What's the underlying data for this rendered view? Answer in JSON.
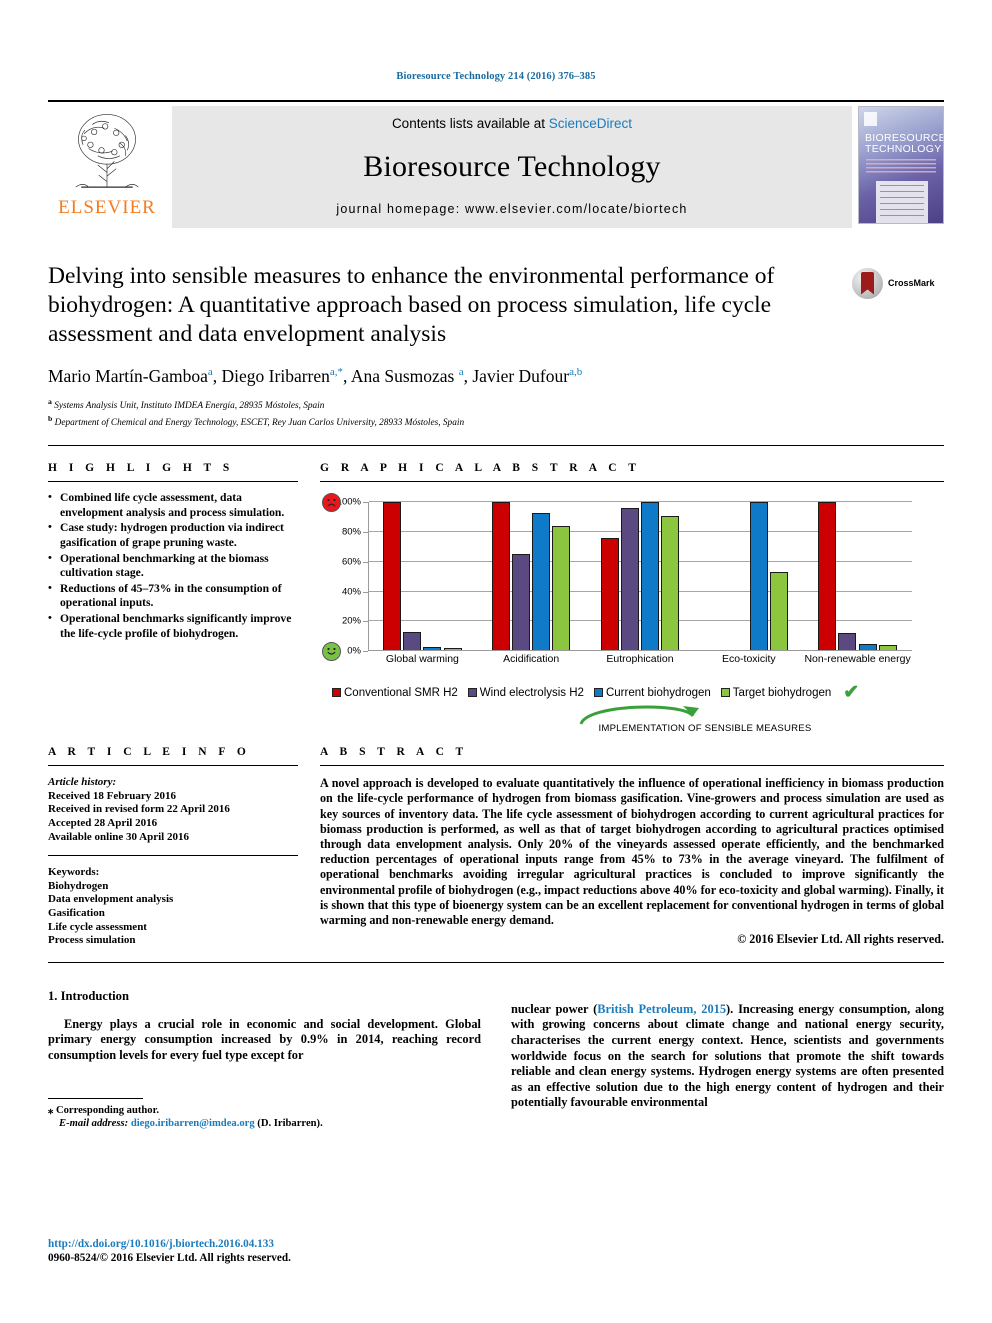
{
  "running_head": "Bioresource Technology 214 (2016) 376–385",
  "masthead": {
    "contents_prefix": "Contents lists available at ",
    "sciencedirect": "ScienceDirect",
    "journal_name": "Bioresource Technology",
    "homepage": "journal homepage: www.elsevier.com/locate/biortech",
    "publisher": "ELSEVIER",
    "cover_title_line1": "BIORESOURCE",
    "cover_title_line2": "TECHNOLOGY"
  },
  "article": {
    "title": "Delving into sensible measures to enhance the environmental performance of biohydrogen: A quantitative approach based on process simulation, life cycle assessment and data envelopment analysis",
    "crossmark_label": "CrossMark",
    "authors_html": "Mario Martín-Gamboa <sup>a</sup>, Diego Iribarren <sup>a,*</sup>, Ana Susmozas <sup>a</sup>, Javier Dufour<sup>a,b</sup>",
    "affiliation_a": "Systems Analysis Unit, Instituto IMDEA Energía, 28935 Móstoles, Spain",
    "affiliation_b": "Department of Chemical and Energy Technology, ESCET, Rey Juan Carlos University, 28933 Móstoles, Spain"
  },
  "highlights": {
    "heading": "H I G H L I G H T S",
    "items": [
      "Combined life cycle assessment, data envelopment analysis and process simulation.",
      "Case study: hydrogen production via indirect gasification of grape pruning waste.",
      "Operational benchmarking at the biomass cultivation stage.",
      "Reductions of 45–73% in the consumption of operational inputs.",
      "Operational benchmarks significantly improve the life-cycle profile of biohydrogen."
    ]
  },
  "graphical_abstract": {
    "heading": "G R A P H I C A L   A B S T R A C T",
    "implementation_caption": "IMPLEMENTATION OF SENSIBLE MEASURES",
    "check_mark": "✔",
    "sad_face_icon": "sad-face-icon",
    "happy_face_icon": "happy-face-icon"
  },
  "chart_data": {
    "type": "bar",
    "title": "",
    "xlabel": "",
    "ylabel": "",
    "ylim": [
      0,
      100
    ],
    "yticks": [
      "0%",
      "20%",
      "40%",
      "60%",
      "80%",
      "100%"
    ],
    "grid": true,
    "legend_position": "bottom",
    "categories": [
      "Global warming",
      "Acidification",
      "Eutrophication",
      "Eco-toxicity",
      "Non-renewable energy"
    ],
    "series": [
      {
        "name": "Conventional SMR H2",
        "color": "#cc0000",
        "values": [
          100,
          100,
          76,
          0.4,
          100
        ]
      },
      {
        "name": "Wind electrolysis H2",
        "color": "#5b4a82",
        "values": [
          13,
          65,
          96,
          0.4,
          12
        ]
      },
      {
        "name": "Current biohydrogen",
        "color": "#0f7ac7",
        "values": [
          3,
          93,
          100,
          100,
          5
        ]
      },
      {
        "name": "Target biohydrogen",
        "color": "#8cc63f",
        "values": [
          2,
          84,
          91,
          53,
          4
        ]
      }
    ]
  },
  "article_info": {
    "heading": "A R T I C L E   I N F O",
    "history_label": "Article history:",
    "history": [
      "Received 18 February 2016",
      "Received in revised form 22 April 2016",
      "Accepted 28 April 2016",
      "Available online 30 April 2016"
    ],
    "keywords_label": "Keywords:",
    "keywords": [
      "Biohydrogen",
      "Data envelopment analysis",
      "Gasification",
      "Life cycle assessment",
      "Process simulation"
    ]
  },
  "abstract": {
    "heading": "A B S T R A C T",
    "text": "A novel approach is developed to evaluate quantitatively the influence of operational inefficiency in biomass production on the life-cycle performance of hydrogen from biomass gasification. Vine-growers and process simulation are used as key sources of inventory data. The life cycle assessment of biohydrogen according to current agricultural practices for biomass production is performed, as well as that of target biohydrogen according to agricultural practices optimised through data envelopment analysis. Only 20% of the vineyards assessed operate efficiently, and the benchmarked reduction percentages of operational inputs range from 45% to 73% in the average vineyard. The fulfilment of operational benchmarks avoiding irregular agricultural practices is concluded to improve significantly the environmental profile of biohydrogen (e.g., impact reductions above 40% for eco-toxicity and global warming). Finally, it is shown that this type of bioenergy system can be an excellent replacement for conventional hydrogen in terms of global warming and non-renewable energy demand.",
    "copyright": "© 2016 Elsevier Ltd. All rights reserved."
  },
  "body": {
    "section_heading": "1. Introduction",
    "left_paragraph": "Energy plays a crucial role in economic and social development. Global primary energy consumption increased by 0.9% in 2014, reaching record consumption levels for every fuel type except for",
    "right_paragraph_pre": "nuclear power (",
    "right_paragraph_link": "British Petroleum, 2015",
    "right_paragraph_post": "). Increasing energy consumption, along with growing concerns about climate change and national energy security, characterises the current energy context. Hence, scientists and governments worldwide focus on the search for solutions that promote the shift towards reliable and clean energy systems. Hydrogen energy systems are often presented as an effective solution due to the high energy content of hydrogen and their potentially favourable environmental",
    "footnote_corresponding": "⁎ Corresponding author.",
    "footnote_email_label": "E-mail address:",
    "footnote_email": "diego.iribarren@imdea.org",
    "footnote_email_suffix": "(D. Iribarren)."
  },
  "footer": {
    "doi": "http://dx.doi.org/10.1016/j.biortech.2016.04.133",
    "issn_line": "0960-8524/© 2016 Elsevier Ltd. All rights reserved."
  }
}
